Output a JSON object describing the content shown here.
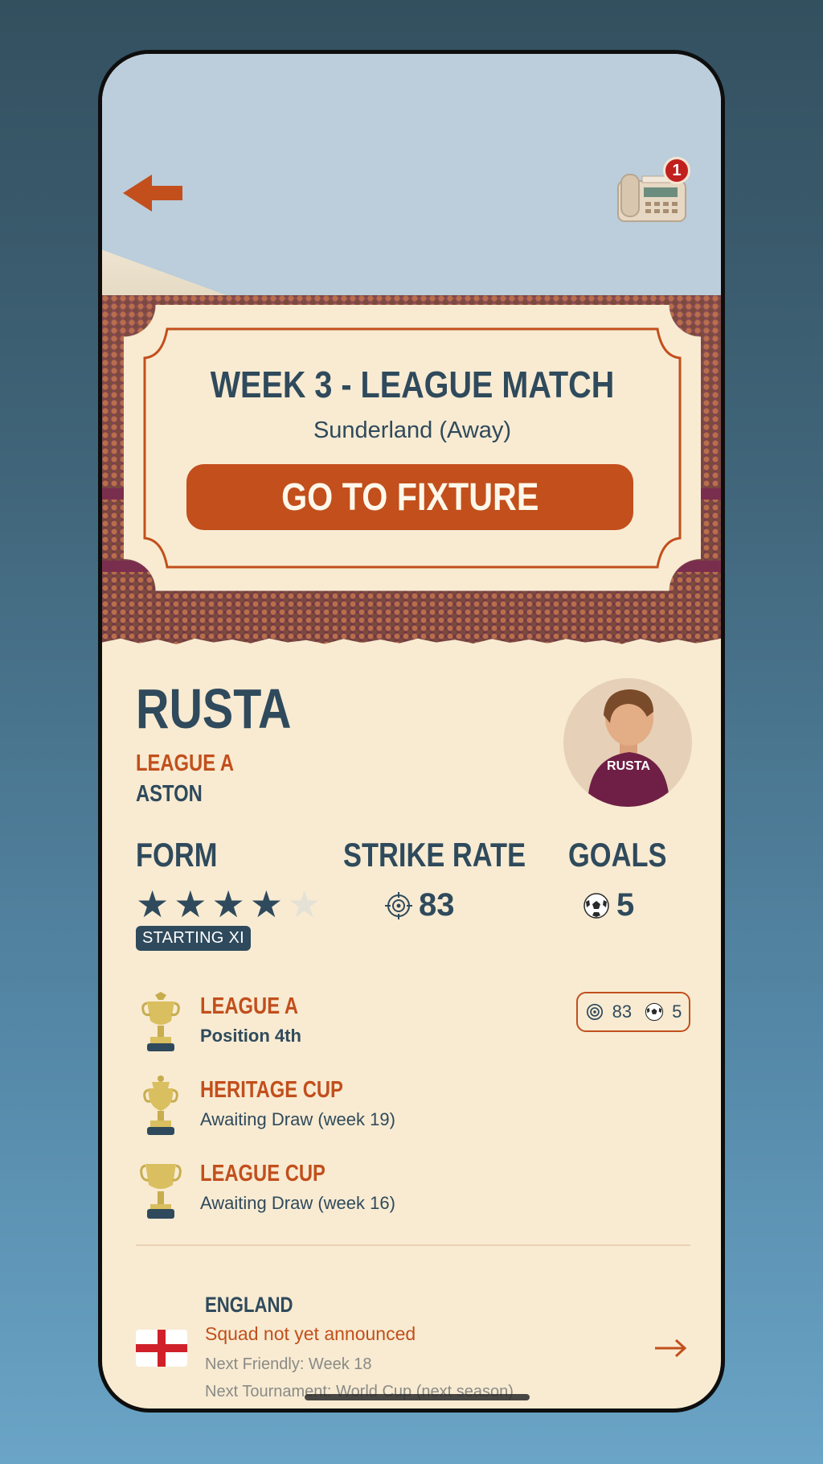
{
  "header": {
    "notification_count": "1"
  },
  "fixture": {
    "title": "WEEK 3 - LEAGUE MATCH",
    "opponent": "Sunderland (Away)",
    "button_label": "GO TO FIXTURE"
  },
  "player": {
    "name": "RUSTA",
    "league": "LEAGUE A",
    "club": "ASTON",
    "shirt_name": "RUSTA"
  },
  "stats": {
    "form_label": "FORM",
    "form_rating": 4,
    "form_max": 5,
    "selection": "STARTING XI",
    "strike_rate_label": "STRIKE RATE",
    "strike_rate": "83",
    "goals_label": "GOALS",
    "goals": "5"
  },
  "competitions": [
    {
      "name": "LEAGUE A",
      "status": "Position 4th",
      "icon": "league-trophy-icon",
      "strike_rate": "83",
      "goals": "5"
    },
    {
      "name": "HERITAGE CUP",
      "status": "Awaiting Draw (week 19)",
      "icon": "cup-trophy-icon"
    },
    {
      "name": "LEAGUE CUP",
      "status": "Awaiting Draw (week 16)",
      "icon": "cup-trophy-icon"
    }
  ],
  "national": {
    "country": "ENGLAND",
    "status": "Squad not yet announced",
    "next_friendly": "Next Friendly: Week 18",
    "next_tournament": "Next Tournament: World Cup (next season)"
  },
  "colors": {
    "accent": "#c24f1c",
    "navy": "#2f4a5c",
    "paper": "#f8ebd2"
  }
}
